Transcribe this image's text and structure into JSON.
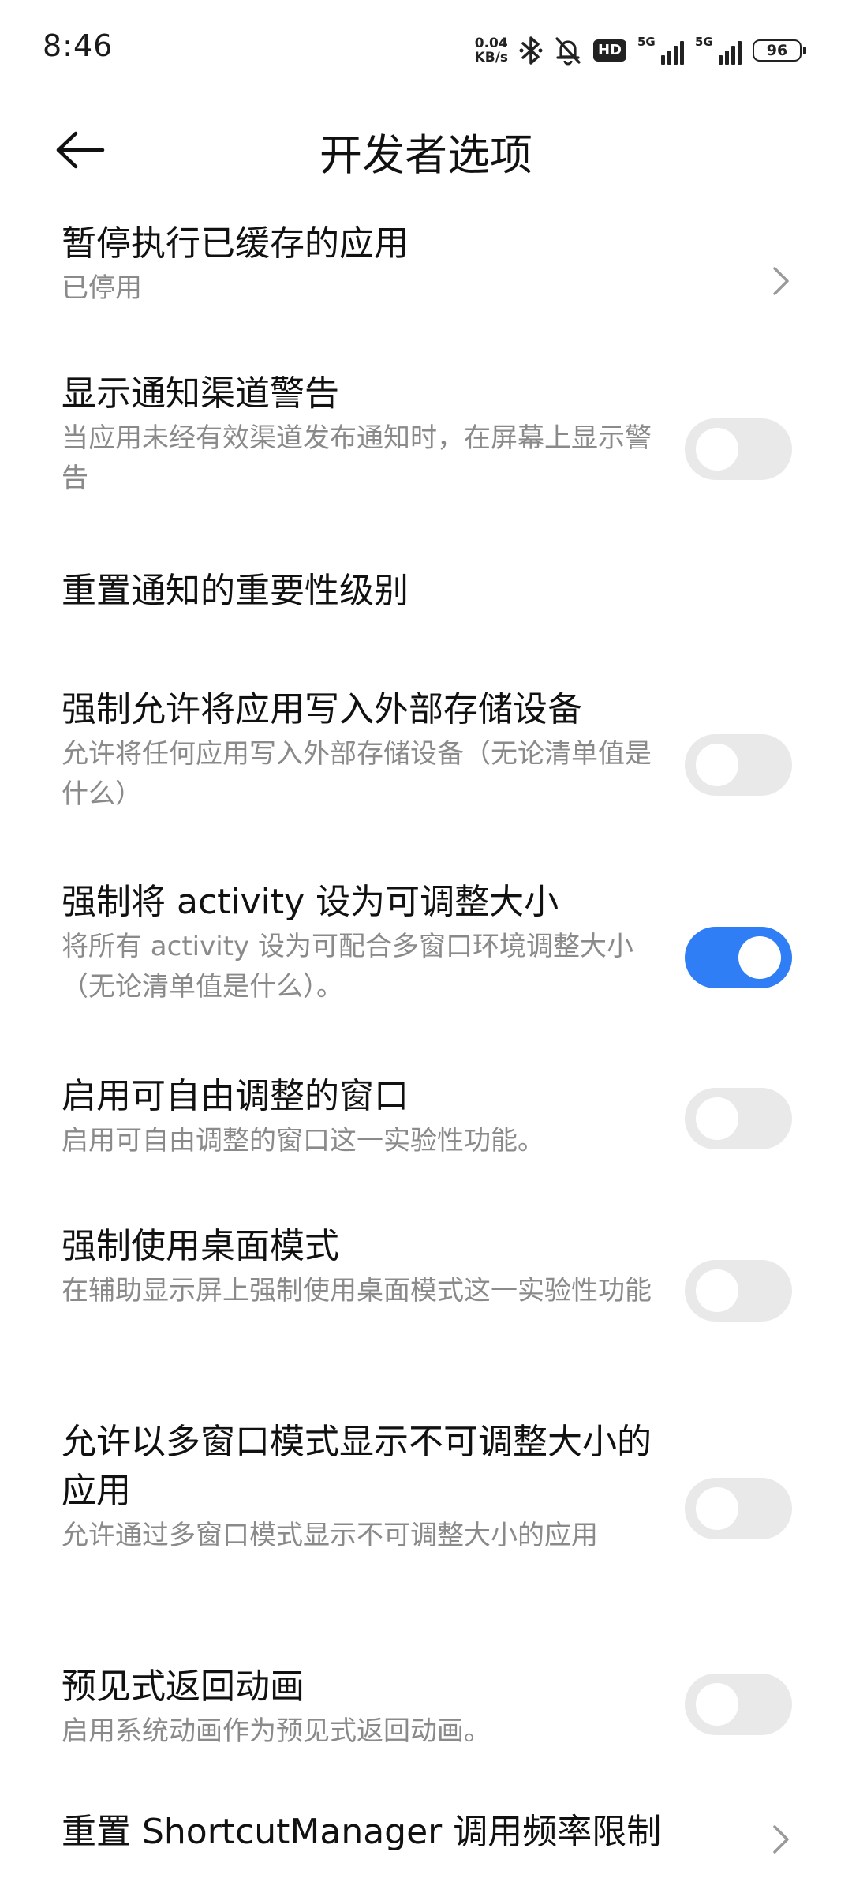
{
  "status_bar": {
    "time": "8:46",
    "net_speed_value": "0.04",
    "net_speed_unit": "KB/s",
    "hd_badge": "HD",
    "signal_1_label": "5G",
    "signal_2_label": "5G",
    "battery_level": "96"
  },
  "header": {
    "title": "开发者选项"
  },
  "settings": [
    {
      "title": "暂停执行已缓存的应用",
      "desc": "已停用",
      "control": "chevron"
    },
    {
      "title": "显示通知渠道警告",
      "desc": "当应用未经有效渠道发布通知时，在屏幕上显示警告",
      "control": "toggle",
      "on": false
    },
    {
      "title": "重置通知的重要性级别",
      "desc": "",
      "control": "none"
    },
    {
      "title": "强制允许将应用写入外部存储设备",
      "desc": "允许将任何应用写入外部存储设备（无论清单值是什么）",
      "control": "toggle",
      "on": false
    },
    {
      "title": "强制将 activity 设为可调整大小",
      "desc": "将所有 activity 设为可配合多窗口环境调整大小（无论清单值是什么）。",
      "control": "toggle",
      "on": true
    },
    {
      "title": "启用可自由调整的窗口",
      "desc": "启用可自由调整的窗口这一实验性功能。",
      "control": "toggle",
      "on": false
    },
    {
      "title": "强制使用桌面模式",
      "desc": "在辅助显示屏上强制使用桌面模式这一实验性功能",
      "control": "toggle",
      "on": false
    },
    {
      "title": "允许以多窗口模式显示不可调整大小的应用",
      "desc": "允许通过多窗口模式显示不可调整大小的应用",
      "control": "toggle",
      "on": false
    },
    {
      "title": "预见式返回动画",
      "desc": "启用系统动画作为预见式返回动画。",
      "control": "toggle",
      "on": false
    },
    {
      "title": "重置 ShortcutManager 调用频率限制",
      "desc": "",
      "control": "chevron"
    }
  ],
  "colors": {
    "accent": "#2f7ef5",
    "toggle_off": "#e9e9e9",
    "secondary_text": "#8a8a8a"
  }
}
